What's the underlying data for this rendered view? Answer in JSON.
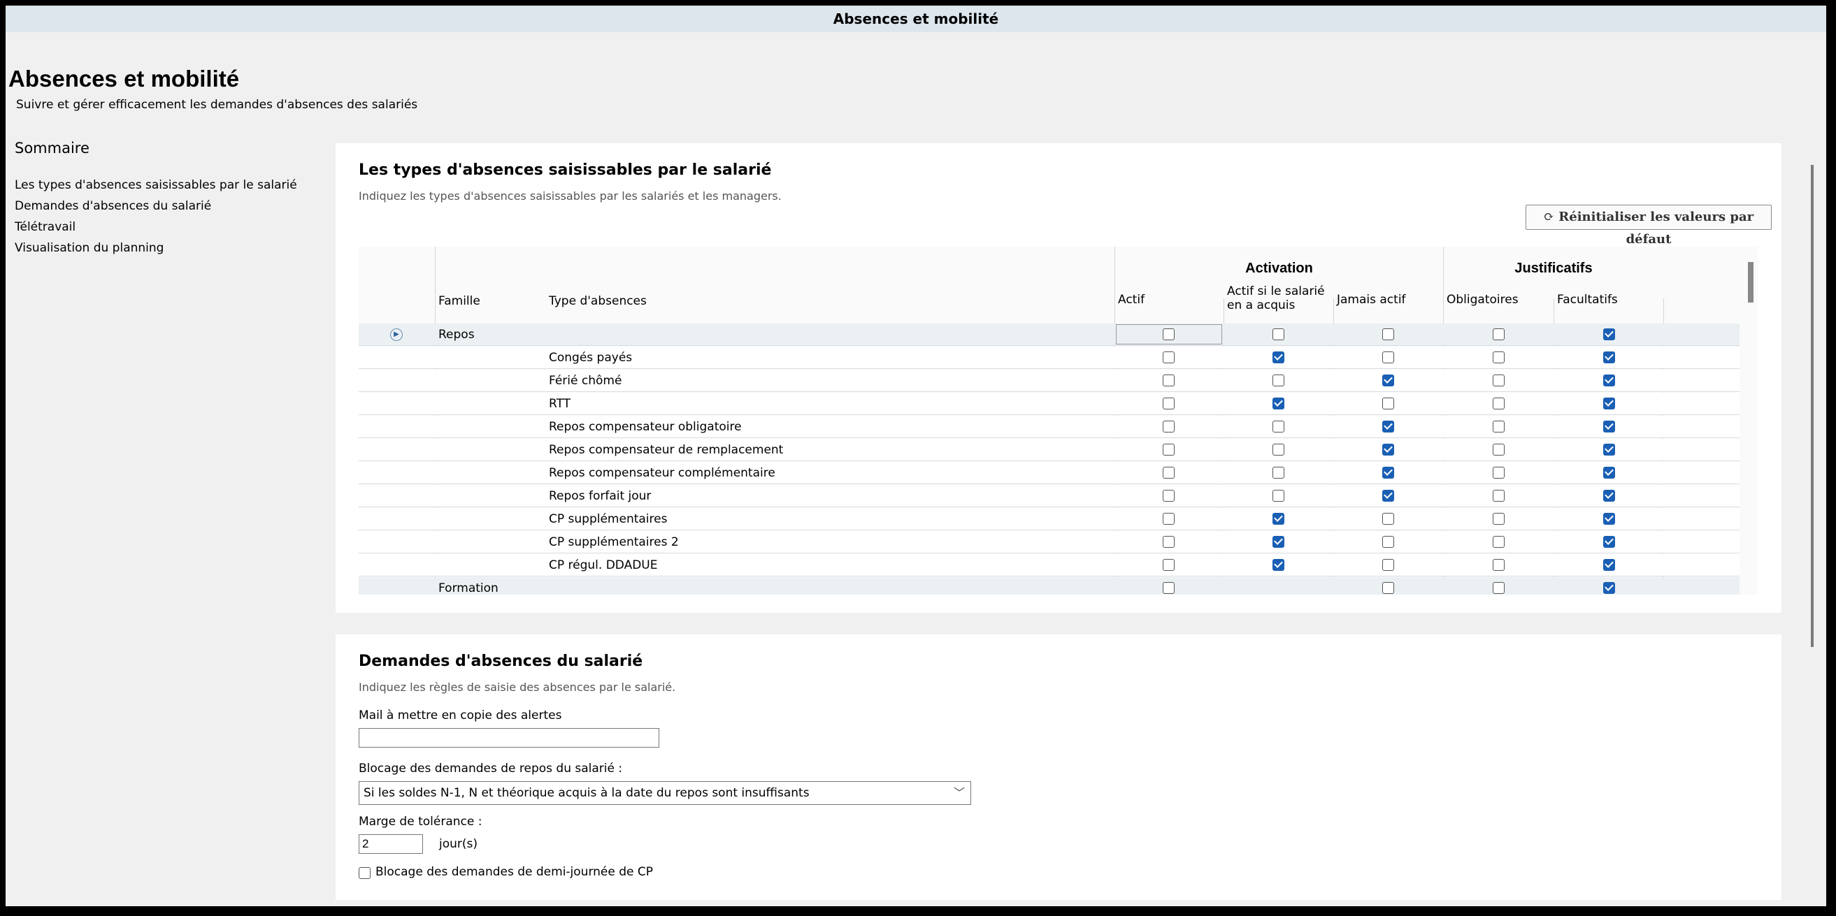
{
  "window": {
    "title": "Absences et mobilité"
  },
  "page": {
    "title": "Absences et mobilité",
    "subtitle": "Suivre et gérer efficacement les demandes d'absences des salariés"
  },
  "sommaire": {
    "title": "Sommaire",
    "items": [
      "Les types d'absences saisissables par le salarié",
      "Demandes d'absences du salarié",
      "Télétravail",
      "Visualisation du planning"
    ]
  },
  "section1": {
    "title": "Les types d'absences saisissables par le salarié",
    "description": "Indiquez les types d'absences saisissables par les salariés et les managers.",
    "reset_label": "Réinitialiser les valeurs par défaut",
    "groups": {
      "activation": "Activation",
      "justificatifs": "Justificatifs"
    },
    "columns": {
      "famille": "Famille",
      "type": "Type d'absences",
      "actif": "Actif",
      "actif_acquis_1": "Actif si le salarié",
      "actif_acquis_2": "en a acquis",
      "jamais": "Jamais actif",
      "obligatoires": "Obligatoires",
      "facultatifs": "Facultatifs"
    },
    "rows": [
      {
        "famille": "Repos",
        "type": "",
        "family_row": true,
        "checks": [
          false,
          false,
          false,
          false,
          true
        ]
      },
      {
        "famille": "",
        "type": "Congés payés",
        "checks": [
          false,
          true,
          false,
          false,
          true
        ]
      },
      {
        "famille": "",
        "type": "Férié chômé",
        "checks": [
          false,
          false,
          true,
          false,
          true
        ]
      },
      {
        "famille": "",
        "type": "RTT",
        "checks": [
          false,
          true,
          false,
          false,
          true
        ]
      },
      {
        "famille": "",
        "type": "Repos compensateur obligatoire",
        "checks": [
          false,
          false,
          true,
          false,
          true
        ]
      },
      {
        "famille": "",
        "type": "Repos compensateur de remplacement",
        "checks": [
          false,
          false,
          true,
          false,
          true
        ]
      },
      {
        "famille": "",
        "type": "Repos compensateur complémentaire",
        "checks": [
          false,
          false,
          true,
          false,
          true
        ]
      },
      {
        "famille": "",
        "type": "Repos forfait jour",
        "checks": [
          false,
          false,
          true,
          false,
          true
        ]
      },
      {
        "famille": "",
        "type": "CP supplémentaires",
        "checks": [
          false,
          true,
          false,
          false,
          true
        ]
      },
      {
        "famille": "",
        "type": "CP supplémentaires 2",
        "checks": [
          false,
          true,
          false,
          false,
          true
        ]
      },
      {
        "famille": "",
        "type": "CP régul. DDADUE",
        "checks": [
          false,
          true,
          false,
          false,
          true
        ]
      },
      {
        "famille": "Formation",
        "type": "",
        "family_row": true,
        "checks": [
          false,
          null,
          false,
          false,
          true
        ]
      }
    ]
  },
  "section2": {
    "title": "Demandes d'absences du salarié",
    "description": "Indiquez les règles de saisie des absences par le salarié.",
    "mail_label": "Mail à mettre en copie des alertes",
    "mail_value": "",
    "blocage_label": "Blocage des demandes de repos du salarié :",
    "blocage_value": "Si les soldes N-1, N et théorique acquis à la date du repos sont insuffisants",
    "marge_label": "Marge de tolérance :",
    "marge_value": "2",
    "marge_unit": "jour(s)",
    "demi_journee_label": "Blocage des demandes de demi-journée de CP",
    "demi_journee_checked": false
  }
}
